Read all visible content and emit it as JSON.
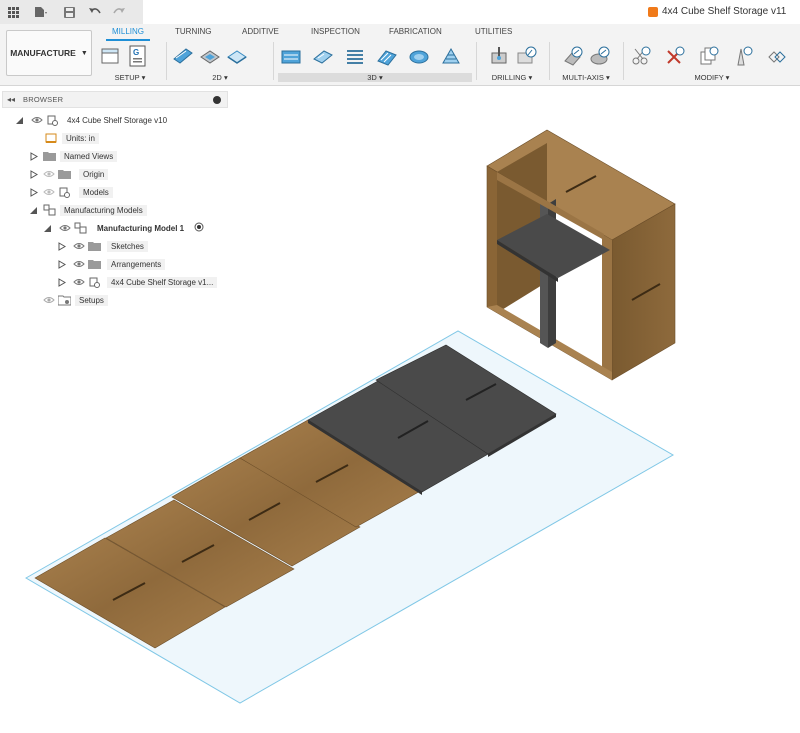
{
  "window": {
    "title": "4x4 Cube Shelf Storage v11",
    "accent": "#1f8fd6",
    "title_icon_color": "#f07a1a"
  },
  "quick_access": {
    "icons": [
      "grid-menu-icon",
      "file-icon",
      "save-icon",
      "undo-icon",
      "redo-icon"
    ]
  },
  "ribbon": {
    "workspace": "MANUFACTURE",
    "tabs": [
      {
        "label": "MILLING",
        "active": true
      },
      {
        "label": "TURNING",
        "active": false
      },
      {
        "label": "ADDITIVE",
        "active": false
      },
      {
        "label": "INSPECTION",
        "active": false
      },
      {
        "label": "FABRICATION",
        "active": false
      },
      {
        "label": "UTILITIES",
        "active": false
      }
    ],
    "groups": [
      {
        "label": "SETUP",
        "dropdown": "▾"
      },
      {
        "label": "2D",
        "dropdown": "▾"
      },
      {
        "label": "3D",
        "dropdown": "▾"
      },
      {
        "label": "DRILLING",
        "dropdown": "▾"
      },
      {
        "label": "MULTI-AXIS",
        "dropdown": "▾"
      },
      {
        "label": "MODIFY",
        "dropdown": "▾"
      }
    ]
  },
  "browser": {
    "title": "BROWSER",
    "items": [
      {
        "label": "4x4 Cube Shelf Storage v10",
        "level": 0
      },
      {
        "label": "Units: in",
        "level": 1
      },
      {
        "label": "Named Views",
        "level": 1
      },
      {
        "label": "Origin",
        "level": 1
      },
      {
        "label": "Models",
        "level": 1
      },
      {
        "label": "Manufacturing Models",
        "level": 1
      },
      {
        "label": "Manufacturing Model 1",
        "level": 2
      },
      {
        "label": "Sketches",
        "level": 3
      },
      {
        "label": "Arrangements",
        "level": 3
      },
      {
        "label": "4x4 Cube Shelf Storage v1...",
        "level": 3
      },
      {
        "label": "Setups",
        "level": 1
      }
    ]
  },
  "viewport": {
    "wood_color": "#9a7444",
    "dark_panel_color": "#4a4a4a",
    "stock_fill": "#eef7fc",
    "stock_outline": "#7fc7e6"
  }
}
